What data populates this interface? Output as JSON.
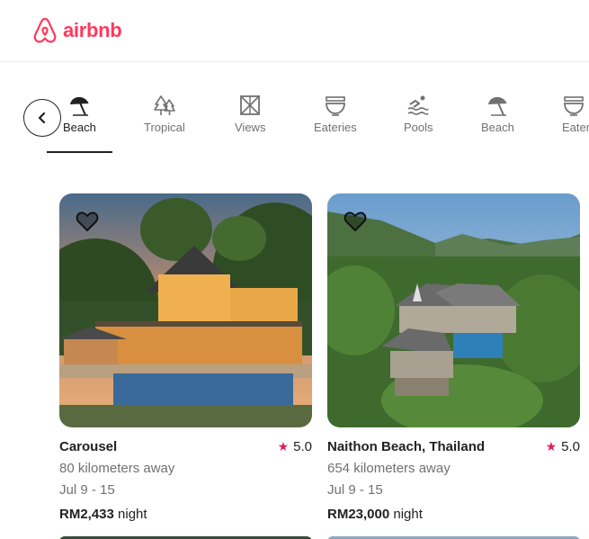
{
  "brand": {
    "name": "airbnb",
    "color": "#FF385C"
  },
  "categories": [
    {
      "label": "Beach",
      "icon": "beach-umbrella-icon",
      "active": true
    },
    {
      "label": "Tropical",
      "icon": "palm-trees-icon",
      "active": false
    },
    {
      "label": "Views",
      "icon": "window-view-icon",
      "active": false
    },
    {
      "label": "Eateries",
      "icon": "noodle-bowl-icon",
      "active": false
    },
    {
      "label": "Pools",
      "icon": "swimmer-icon",
      "active": false
    },
    {
      "label": "Beach",
      "icon": "beach-umbrella-icon",
      "active": false
    },
    {
      "label": "Eater",
      "icon": "noodle-bowl-icon",
      "active": false
    }
  ],
  "listings": [
    {
      "title": "Carousel",
      "rating": "5.0",
      "distance": "80 kilometers away",
      "dates": "Jul 9 - 15",
      "price": "RM2,433",
      "price_unit": " night"
    },
    {
      "title": "Naithon Beach, Thailand",
      "rating": "5.0",
      "distance": "654 kilometers away",
      "dates": "Jul 9 - 15",
      "price": "RM23,000",
      "price_unit": " night"
    }
  ],
  "colors": {
    "accent": "#FF385C",
    "star": "#E31C5F",
    "muted": "#717171",
    "text": "#222222"
  }
}
